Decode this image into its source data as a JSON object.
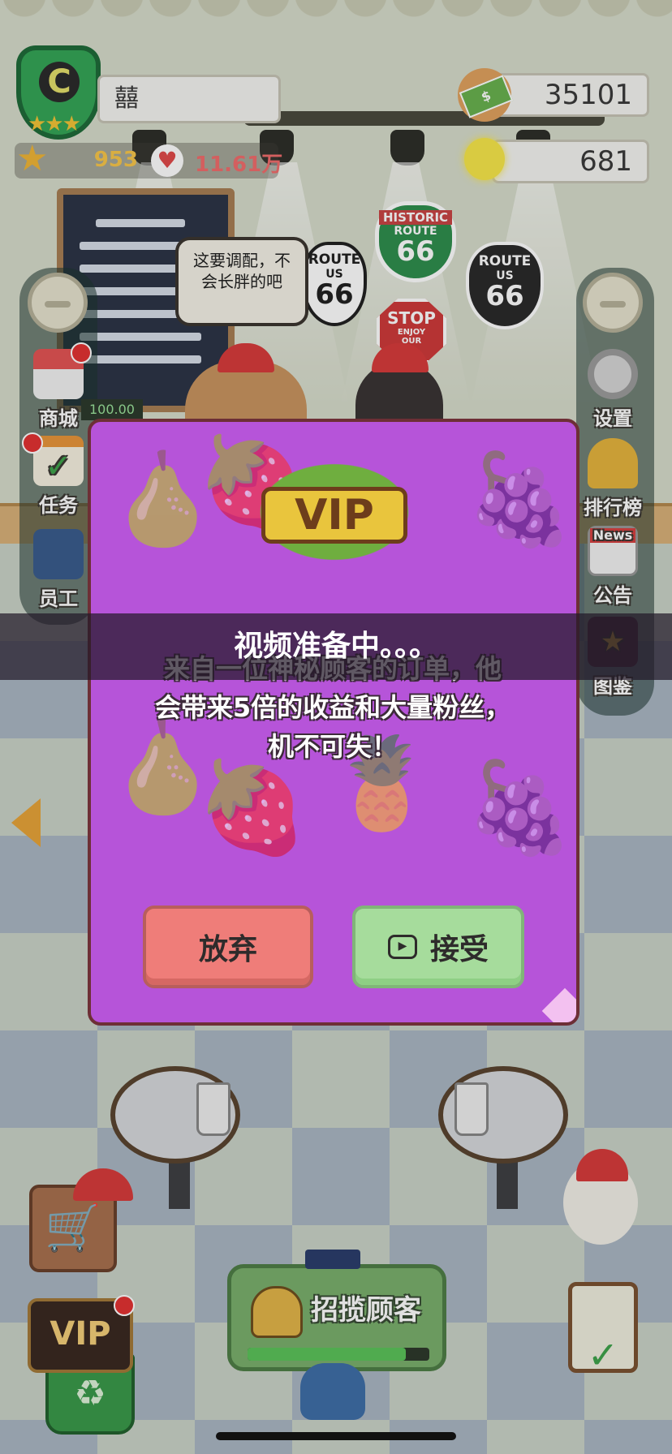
{
  "player": {
    "rank_letter": "C",
    "name": "囍",
    "stars": "953",
    "fans": "11.61万"
  },
  "currency": {
    "money": "35101",
    "ideas": "681"
  },
  "speech": {
    "text": "这要调配，不会长胖的吧"
  },
  "signs": {
    "historic_top": "HISTORIC",
    "historic_route": "ROUTE",
    "historic_num": "66",
    "left_route": "ROUTE",
    "left_us": "US",
    "left_num": "66",
    "right_route": "ROUTE",
    "right_us": "US",
    "right_num": "66",
    "stop": "STOP",
    "stop_sub": "ENJOY",
    "stop_sub2": "OUR",
    "price_tag": "100.00"
  },
  "left_menu": [
    {
      "label": "商城"
    },
    {
      "label": "任务"
    },
    {
      "label": "员工"
    }
  ],
  "right_menu": [
    {
      "label": "设置"
    },
    {
      "label": "排行榜"
    },
    {
      "label": "公告",
      "icon_text": "News"
    },
    {
      "label": "图鉴"
    }
  ],
  "modal": {
    "badge": "VIP",
    "description_line1": "来自一位神秘顾客的订单，他",
    "description_line2": "会带来5倍的收益和大量粉丝，",
    "description_line3": "机不可失！",
    "decline_label": "放弃",
    "accept_label": "接受"
  },
  "toast": {
    "text": "视频准备中。。。"
  },
  "bottom": {
    "vip_label": "VIP",
    "attract_label": "招揽顾客",
    "attract_progress": 0.87
  },
  "colors": {
    "modal_bg": "#b654d9",
    "decline": "#ef7d79",
    "accept": "#a6dc9c",
    "progress": "#5cc35b"
  }
}
